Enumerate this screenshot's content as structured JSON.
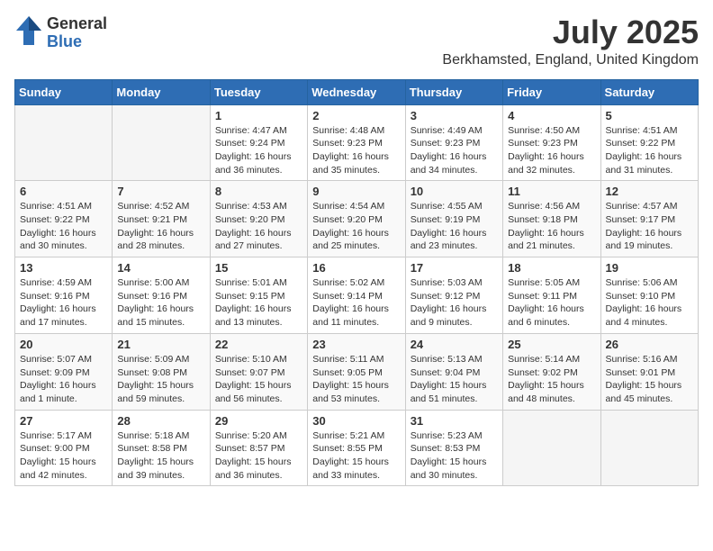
{
  "logo": {
    "general": "General",
    "blue": "Blue"
  },
  "title": {
    "month_year": "July 2025",
    "location": "Berkhamsted, England, United Kingdom"
  },
  "days_of_week": [
    "Sunday",
    "Monday",
    "Tuesday",
    "Wednesday",
    "Thursday",
    "Friday",
    "Saturday"
  ],
  "weeks": [
    [
      {
        "day": "",
        "empty": true
      },
      {
        "day": "",
        "empty": true
      },
      {
        "day": "1",
        "line1": "Sunrise: 4:47 AM",
        "line2": "Sunset: 9:24 PM",
        "line3": "Daylight: 16 hours",
        "line4": "and 36 minutes."
      },
      {
        "day": "2",
        "line1": "Sunrise: 4:48 AM",
        "line2": "Sunset: 9:23 PM",
        "line3": "Daylight: 16 hours",
        "line4": "and 35 minutes."
      },
      {
        "day": "3",
        "line1": "Sunrise: 4:49 AM",
        "line2": "Sunset: 9:23 PM",
        "line3": "Daylight: 16 hours",
        "line4": "and 34 minutes."
      },
      {
        "day": "4",
        "line1": "Sunrise: 4:50 AM",
        "line2": "Sunset: 9:23 PM",
        "line3": "Daylight: 16 hours",
        "line4": "and 32 minutes."
      },
      {
        "day": "5",
        "line1": "Sunrise: 4:51 AM",
        "line2": "Sunset: 9:22 PM",
        "line3": "Daylight: 16 hours",
        "line4": "and 31 minutes."
      }
    ],
    [
      {
        "day": "6",
        "line1": "Sunrise: 4:51 AM",
        "line2": "Sunset: 9:22 PM",
        "line3": "Daylight: 16 hours",
        "line4": "and 30 minutes."
      },
      {
        "day": "7",
        "line1": "Sunrise: 4:52 AM",
        "line2": "Sunset: 9:21 PM",
        "line3": "Daylight: 16 hours",
        "line4": "and 28 minutes."
      },
      {
        "day": "8",
        "line1": "Sunrise: 4:53 AM",
        "line2": "Sunset: 9:20 PM",
        "line3": "Daylight: 16 hours",
        "line4": "and 27 minutes."
      },
      {
        "day": "9",
        "line1": "Sunrise: 4:54 AM",
        "line2": "Sunset: 9:20 PM",
        "line3": "Daylight: 16 hours",
        "line4": "and 25 minutes."
      },
      {
        "day": "10",
        "line1": "Sunrise: 4:55 AM",
        "line2": "Sunset: 9:19 PM",
        "line3": "Daylight: 16 hours",
        "line4": "and 23 minutes."
      },
      {
        "day": "11",
        "line1": "Sunrise: 4:56 AM",
        "line2": "Sunset: 9:18 PM",
        "line3": "Daylight: 16 hours",
        "line4": "and 21 minutes."
      },
      {
        "day": "12",
        "line1": "Sunrise: 4:57 AM",
        "line2": "Sunset: 9:17 PM",
        "line3": "Daylight: 16 hours",
        "line4": "and 19 minutes."
      }
    ],
    [
      {
        "day": "13",
        "line1": "Sunrise: 4:59 AM",
        "line2": "Sunset: 9:16 PM",
        "line3": "Daylight: 16 hours",
        "line4": "and 17 minutes."
      },
      {
        "day": "14",
        "line1": "Sunrise: 5:00 AM",
        "line2": "Sunset: 9:16 PM",
        "line3": "Daylight: 16 hours",
        "line4": "and 15 minutes."
      },
      {
        "day": "15",
        "line1": "Sunrise: 5:01 AM",
        "line2": "Sunset: 9:15 PM",
        "line3": "Daylight: 16 hours",
        "line4": "and 13 minutes."
      },
      {
        "day": "16",
        "line1": "Sunrise: 5:02 AM",
        "line2": "Sunset: 9:14 PM",
        "line3": "Daylight: 16 hours",
        "line4": "and 11 minutes."
      },
      {
        "day": "17",
        "line1": "Sunrise: 5:03 AM",
        "line2": "Sunset: 9:12 PM",
        "line3": "Daylight: 16 hours",
        "line4": "and 9 minutes."
      },
      {
        "day": "18",
        "line1": "Sunrise: 5:05 AM",
        "line2": "Sunset: 9:11 PM",
        "line3": "Daylight: 16 hours",
        "line4": "and 6 minutes."
      },
      {
        "day": "19",
        "line1": "Sunrise: 5:06 AM",
        "line2": "Sunset: 9:10 PM",
        "line3": "Daylight: 16 hours",
        "line4": "and 4 minutes."
      }
    ],
    [
      {
        "day": "20",
        "line1": "Sunrise: 5:07 AM",
        "line2": "Sunset: 9:09 PM",
        "line3": "Daylight: 16 hours",
        "line4": "and 1 minute."
      },
      {
        "day": "21",
        "line1": "Sunrise: 5:09 AM",
        "line2": "Sunset: 9:08 PM",
        "line3": "Daylight: 15 hours",
        "line4": "and 59 minutes."
      },
      {
        "day": "22",
        "line1": "Sunrise: 5:10 AM",
        "line2": "Sunset: 9:07 PM",
        "line3": "Daylight: 15 hours",
        "line4": "and 56 minutes."
      },
      {
        "day": "23",
        "line1": "Sunrise: 5:11 AM",
        "line2": "Sunset: 9:05 PM",
        "line3": "Daylight: 15 hours",
        "line4": "and 53 minutes."
      },
      {
        "day": "24",
        "line1": "Sunrise: 5:13 AM",
        "line2": "Sunset: 9:04 PM",
        "line3": "Daylight: 15 hours",
        "line4": "and 51 minutes."
      },
      {
        "day": "25",
        "line1": "Sunrise: 5:14 AM",
        "line2": "Sunset: 9:02 PM",
        "line3": "Daylight: 15 hours",
        "line4": "and 48 minutes."
      },
      {
        "day": "26",
        "line1": "Sunrise: 5:16 AM",
        "line2": "Sunset: 9:01 PM",
        "line3": "Daylight: 15 hours",
        "line4": "and 45 minutes."
      }
    ],
    [
      {
        "day": "27",
        "line1": "Sunrise: 5:17 AM",
        "line2": "Sunset: 9:00 PM",
        "line3": "Daylight: 15 hours",
        "line4": "and 42 minutes."
      },
      {
        "day": "28",
        "line1": "Sunrise: 5:18 AM",
        "line2": "Sunset: 8:58 PM",
        "line3": "Daylight: 15 hours",
        "line4": "and 39 minutes."
      },
      {
        "day": "29",
        "line1": "Sunrise: 5:20 AM",
        "line2": "Sunset: 8:57 PM",
        "line3": "Daylight: 15 hours",
        "line4": "and 36 minutes."
      },
      {
        "day": "30",
        "line1": "Sunrise: 5:21 AM",
        "line2": "Sunset: 8:55 PM",
        "line3": "Daylight: 15 hours",
        "line4": "and 33 minutes."
      },
      {
        "day": "31",
        "line1": "Sunrise: 5:23 AM",
        "line2": "Sunset: 8:53 PM",
        "line3": "Daylight: 15 hours",
        "line4": "and 30 minutes."
      },
      {
        "day": "",
        "empty": true
      },
      {
        "day": "",
        "empty": true
      }
    ]
  ]
}
